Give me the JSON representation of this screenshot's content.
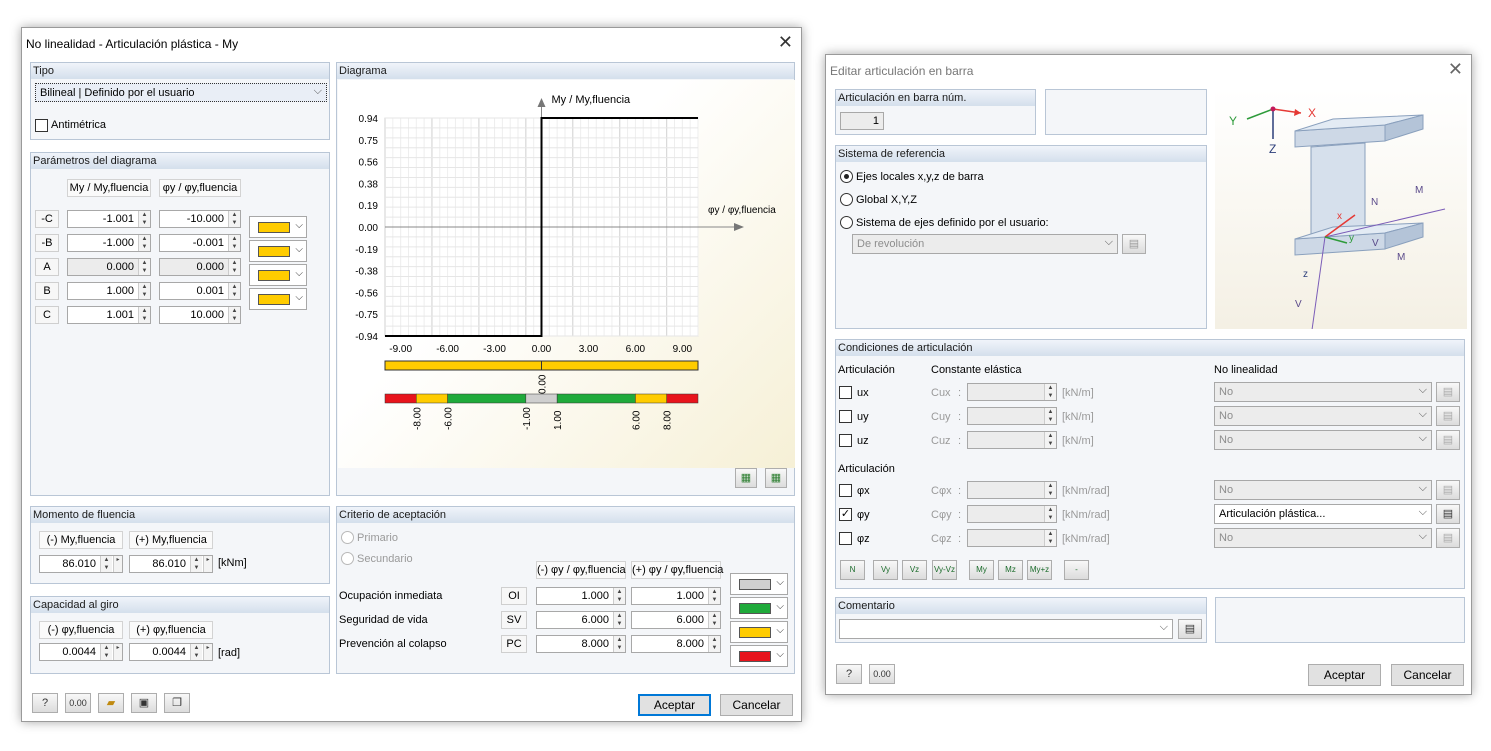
{
  "w1": {
    "title": "No linealidad - Articulación plástica - My",
    "tipo": {
      "header": "Tipo",
      "combo": "Bilineal | Definido por el usuario",
      "antimetrica": "Antimétrica"
    },
    "params": {
      "header": "Parámetros del diagrama",
      "col1": "My / My,fluencia",
      "col2": "φy / φy,fluencia",
      "rows": [
        {
          "label": "-C",
          "v1": "-1.001",
          "v2": "-10.000"
        },
        {
          "label": "-B",
          "v1": "-1.000",
          "v2": "-0.001"
        },
        {
          "label": "A",
          "v1": "0.000",
          "v2": "0.000"
        },
        {
          "label": "B",
          "v1": "1.000",
          "v2": "0.001"
        },
        {
          "label": "C",
          "v1": "1.001",
          "v2": "10.000"
        }
      ]
    },
    "diagrama": {
      "header": "Diagrama",
      "yaxis_label": "My / My,fluencia",
      "xaxis_label": "φy / φy,fluencia",
      "bar_label": "0.00",
      "limit_labels": [
        "-8.00",
        "-6.00",
        "-1.00",
        "1.00",
        "6.00",
        "8.00"
      ]
    },
    "momento": {
      "header": "Momento de fluencia",
      "col_neg": "(-) My,fluencia",
      "col_pos": "(+) My,fluencia",
      "neg": "86.010",
      "pos": "86.010",
      "unit": "[kNm]"
    },
    "giro": {
      "header": "Capacidad al giro",
      "col_neg": "(-) φy,fluencia",
      "col_pos": "(+) φy,fluencia",
      "neg": "0.0044",
      "pos": "0.0044",
      "unit": "[rad]"
    },
    "criterio": {
      "header": "Criterio de aceptación",
      "primario": "Primario",
      "secundario": "Secundario",
      "col_neg": "(-) φy / φy,fluencia",
      "col_pos": "(+) φy / φy,fluencia",
      "rows": [
        {
          "label": "Ocupación inmediata",
          "abbr": "OI",
          "neg": "1.000",
          "pos": "1.000"
        },
        {
          "label": "Seguridad de vida",
          "abbr": "SV",
          "neg": "6.000",
          "pos": "6.000"
        },
        {
          "label": "Prevención al colapso",
          "abbr": "PC",
          "neg": "8.000",
          "pos": "8.000"
        }
      ]
    },
    "aceptar": "Aceptar",
    "cancelar": "Cancelar"
  },
  "chart_data": {
    "type": "line",
    "title": "",
    "xlabel": "φy / φy,fluencia",
    "ylabel": "My / My,fluencia",
    "xlim": [
      -10,
      10
    ],
    "ylim": [
      -0.94,
      0.94
    ],
    "xticks": [
      "-9.00",
      "-6.00",
      "-3.00",
      "0.00",
      "3.00",
      "6.00",
      "9.00"
    ],
    "yticks": [
      "0.94",
      "0.75",
      "0.56",
      "0.38",
      "0.19",
      "0.00",
      "-0.19",
      "-0.38",
      "-0.56",
      "-0.75",
      "-0.94"
    ],
    "series": [
      {
        "x": [
          -10,
          -0.001,
          0,
          0.001,
          10
        ],
        "y": [
          -1.001,
          -1.0,
          0,
          1.0,
          1.001
        ]
      }
    ],
    "grid": true
  },
  "w2": {
    "title": "Editar articulación en barra",
    "num": {
      "header": "Articulación en barra núm.",
      "value": "1"
    },
    "sistema": {
      "header": "Sistema de referencia",
      "opt1": "Ejes locales x,y,z de barra",
      "opt2": "Global X,Y,Z",
      "opt3": "Sistema de ejes definido por el usuario:",
      "combo": "De revolución"
    },
    "cond": {
      "header": "Condiciones de articulación",
      "col1": "Articulación",
      "col2": "Constante elástica",
      "col3": "No linealidad",
      "art2": "Articulación",
      "rows": [
        {
          "label": "ux",
          "c": "Cux",
          "unit": "[kN/m]",
          "nl": "No",
          "checked": false,
          "active": false
        },
        {
          "label": "uy",
          "c": "Cuy",
          "unit": "[kN/m]",
          "nl": "No",
          "checked": false,
          "active": false
        },
        {
          "label": "uz",
          "c": "Cuz",
          "unit": "[kN/m]",
          "nl": "No",
          "checked": false,
          "active": false
        },
        {
          "label": "φx",
          "c": "Cφx",
          "unit": "[kNm/rad]",
          "nl": "No",
          "checked": false,
          "active": false
        },
        {
          "label": "φy",
          "c": "Cφy",
          "unit": "[kNm/rad]",
          "nl": "Articulación plástica...",
          "checked": true,
          "active": true
        },
        {
          "label": "φz",
          "c": "Cφz",
          "unit": "[kNm/rad]",
          "nl": "No",
          "checked": false,
          "active": false
        }
      ],
      "tools": [
        "N",
        "Vy",
        "Vz",
        "Vy-Vz",
        "My",
        "Mz",
        "My+z",
        "-"
      ]
    },
    "comentario": {
      "header": "Comentario"
    },
    "aceptar": "Aceptar",
    "cancelar": "Cancelar"
  },
  "colors": {
    "yellow": "#ffcc00",
    "green": "#1faa3b",
    "red": "#e8141c",
    "gray": "#cfcfcf",
    "accent": "#0078d7"
  }
}
